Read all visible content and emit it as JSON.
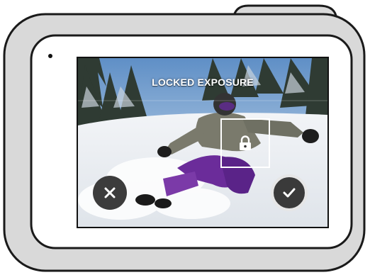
{
  "screen": {
    "title": "LOCKED EXPOSURE"
  },
  "focus_box": {
    "icon": "lock-icon"
  },
  "buttons": {
    "cancel_icon": "close-icon",
    "confirm_icon": "checkmark-icon"
  },
  "colors": {
    "camera_body": "#d9d9d9",
    "camera_outline": "#1a1a1a",
    "button_fill": "#3a3a3a",
    "overlay_text": "#ffffff"
  }
}
